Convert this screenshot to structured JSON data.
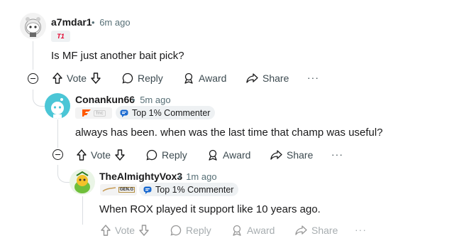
{
  "comments": [
    {
      "username": "a7mdar1",
      "time": "6m ago",
      "separator": "•",
      "flair": "T1",
      "body": "Is MF just another bait pick?",
      "actions": {
        "vote": "Vote",
        "reply": "Reply",
        "award": "Award",
        "share": "Share",
        "more": "···"
      }
    },
    {
      "username": "Conankun66",
      "time": "5m ago",
      "separator": "•",
      "flair": "fnc",
      "badge": "Top 1% Commenter",
      "body": "always has been. when was the last time that champ was useful?",
      "actions": {
        "vote": "Vote",
        "reply": "Reply",
        "award": "Award",
        "share": "Share",
        "more": "···"
      }
    },
    {
      "username": "TheAlmightyVox3",
      "time": "1m ago",
      "separator": "•",
      "flair": "GEN.G",
      "badge": "Top 1% Commenter",
      "body": "When ROX played it support like 10 years ago.",
      "actions": {
        "vote": "Vote",
        "reply": "Reply",
        "award": "Award",
        "share": "Share",
        "more": "···"
      }
    }
  ],
  "colors": {
    "accent_t1": "#e2012d",
    "fnatic": "#ff5900",
    "badge_icon": "#1c6bd0",
    "muted": "#576f76"
  }
}
